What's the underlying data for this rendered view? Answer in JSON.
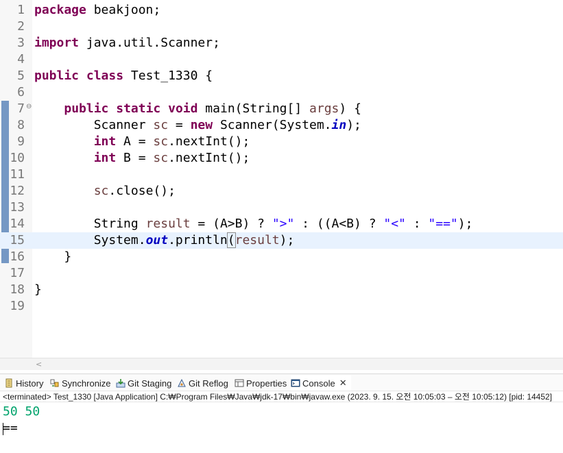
{
  "editor": {
    "lines": [
      {
        "n": "1",
        "fold": "",
        "segs": [
          {
            "c": "kw",
            "t": "package"
          },
          {
            "c": "",
            "t": " beakjoon;"
          }
        ]
      },
      {
        "n": "2",
        "fold": "",
        "segs": []
      },
      {
        "n": "3",
        "fold": "",
        "segs": [
          {
            "c": "kw",
            "t": "import"
          },
          {
            "c": "",
            "t": " java.util.Scanner;"
          }
        ]
      },
      {
        "n": "4",
        "fold": "",
        "segs": []
      },
      {
        "n": "5",
        "fold": "",
        "segs": [
          {
            "c": "kw",
            "t": "public"
          },
          {
            "c": "",
            "t": " "
          },
          {
            "c": "kw",
            "t": "class"
          },
          {
            "c": "",
            "t": " Test_1330 {"
          }
        ]
      },
      {
        "n": "6",
        "fold": "",
        "segs": []
      },
      {
        "n": "7",
        "fold": "⊖",
        "segs": [
          {
            "c": "",
            "t": "    "
          },
          {
            "c": "kw",
            "t": "public"
          },
          {
            "c": "",
            "t": " "
          },
          {
            "c": "kw",
            "t": "static"
          },
          {
            "c": "",
            "t": " "
          },
          {
            "c": "kw",
            "t": "void"
          },
          {
            "c": "",
            "t": " main(String[] "
          },
          {
            "c": "var",
            "t": "args"
          },
          {
            "c": "",
            "t": ") {"
          }
        ]
      },
      {
        "n": "8",
        "fold": "",
        "segs": [
          {
            "c": "",
            "t": "        Scanner "
          },
          {
            "c": "var",
            "t": "sc"
          },
          {
            "c": "",
            "t": " = "
          },
          {
            "c": "kw",
            "t": "new"
          },
          {
            "c": "",
            "t": " Scanner(System."
          },
          {
            "c": "fld",
            "t": "in"
          },
          {
            "c": "",
            "t": ");"
          }
        ]
      },
      {
        "n": "9",
        "fold": "",
        "segs": [
          {
            "c": "",
            "t": "        "
          },
          {
            "c": "kw",
            "t": "int"
          },
          {
            "c": "",
            "t": " A = "
          },
          {
            "c": "var",
            "t": "sc"
          },
          {
            "c": "",
            "t": ".nextInt();"
          }
        ]
      },
      {
        "n": "10",
        "fold": "",
        "segs": [
          {
            "c": "",
            "t": "        "
          },
          {
            "c": "kw",
            "t": "int"
          },
          {
            "c": "",
            "t": " B = "
          },
          {
            "c": "var",
            "t": "sc"
          },
          {
            "c": "",
            "t": ".nextInt();"
          }
        ]
      },
      {
        "n": "11",
        "fold": "",
        "segs": []
      },
      {
        "n": "12",
        "fold": "",
        "segs": [
          {
            "c": "",
            "t": "        "
          },
          {
            "c": "var",
            "t": "sc"
          },
          {
            "c": "",
            "t": ".close();"
          }
        ]
      },
      {
        "n": "13",
        "fold": "",
        "segs": []
      },
      {
        "n": "14",
        "fold": "",
        "segs": [
          {
            "c": "",
            "t": "        String "
          },
          {
            "c": "var",
            "t": "result"
          },
          {
            "c": "",
            "t": " = (A>B) ? "
          },
          {
            "c": "str",
            "t": "\">\""
          },
          {
            "c": "",
            "t": " : ((A<B) ? "
          },
          {
            "c": "str",
            "t": "\"<\""
          },
          {
            "c": "",
            "t": " : "
          },
          {
            "c": "str",
            "t": "\"==\""
          },
          {
            "c": "",
            "t": ");"
          }
        ]
      },
      {
        "n": "15",
        "fold": "",
        "segs": [
          {
            "c": "",
            "t": "        System."
          },
          {
            "c": "fld",
            "t": "out"
          },
          {
            "c": "",
            "t": ".println"
          },
          {
            "c": "bracket",
            "t": "("
          },
          {
            "c": "var",
            "t": "result"
          },
          {
            "c": "",
            "t": ");"
          }
        ]
      },
      {
        "n": "16",
        "fold": "",
        "segs": [
          {
            "c": "",
            "t": "    }"
          }
        ]
      },
      {
        "n": "17",
        "fold": "",
        "segs": []
      },
      {
        "n": "18",
        "fold": "",
        "segs": [
          {
            "c": "",
            "t": "}"
          }
        ]
      },
      {
        "n": "19",
        "fold": "",
        "segs": []
      }
    ],
    "current_line": 15,
    "scroll_left_glyph": "<"
  },
  "tabs": [
    {
      "label": "History",
      "icon": "history-icon",
      "active": false
    },
    {
      "label": "Synchronize",
      "icon": "synchronize-icon",
      "active": false
    },
    {
      "label": "Git Staging",
      "icon": "git-staging-icon",
      "active": false
    },
    {
      "label": "Git Reflog",
      "icon": "git-reflog-icon",
      "active": false
    },
    {
      "label": "Properties",
      "icon": "properties-icon",
      "active": false
    },
    {
      "label": "Console",
      "icon": "console-icon",
      "active": true,
      "close": "✕"
    }
  ],
  "console": {
    "status": "<terminated> Test_1330 [Java Application] C:₩Program Files₩Java₩jdk-17₩bin₩javaw.exe  (2023. 9. 15. 오전 10:05:03 – 오전 10:05:12) [pid: 14452]",
    "input_line": "50 50",
    "output_line": "==",
    "colors": {
      "input": "#00a36c",
      "output": "#000000"
    }
  }
}
